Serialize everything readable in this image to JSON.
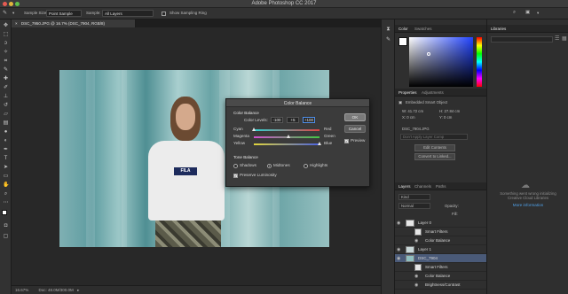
{
  "window": {
    "title": "Adobe Photoshop CC 2017"
  },
  "options_bar": {
    "sample_size_label": "Sample Size:",
    "sample_size_value": "Point Sample",
    "sample_value": "All Layers",
    "show_sampling_ring": "Show Sampling Ring"
  },
  "document": {
    "tab_label": "DSC_7950.JPG @ 16.7% (DSC_7904, RGB/8)",
    "zoom": "16.67%",
    "doc_info": "Doc: 48.0M/300.0M"
  },
  "dialog": {
    "title": "Color Balance",
    "section_color": "Color Balance",
    "color_levels_label": "Color Levels:",
    "levels": [
      "-100",
      "+5",
      "+100"
    ],
    "sliders": [
      {
        "left": "Cyan",
        "right": "Red",
        "value": -100
      },
      {
        "left": "Magenta",
        "right": "Green",
        "value": 5
      },
      {
        "left": "Yellow",
        "right": "Blue",
        "value": 100
      }
    ],
    "section_tone": "Tone Balance",
    "tones": [
      "Shadows",
      "Midtones",
      "Highlights"
    ],
    "preserve_luminosity": "Preserve Luminosity",
    "ok": "OK",
    "cancel": "Cancel",
    "preview": "Preview"
  },
  "color_panel": {
    "tabs": [
      "Color",
      "Swatches"
    ]
  },
  "properties": {
    "tabs": [
      "Properties",
      "Adjustments"
    ],
    "type": "Embedded Smart Object",
    "w": "W: 41.72 cm",
    "h": "H: 27.84 cm",
    "x": "X: 0 cm",
    "y": "Y: 0 cm",
    "filename": "DSC_7904.JPG",
    "layer_comp": "Don't Apply Layer Comp",
    "edit_contents": "Edit Contents",
    "convert": "Convert to Linked..."
  },
  "layers_panel": {
    "tabs": [
      "Layers",
      "Channels",
      "Paths"
    ],
    "kind": "Kind",
    "blend": "Normal",
    "opacity": "Opacity:",
    "fill": "Fill:",
    "rows": [
      {
        "name": "Layer 0",
        "selected": false
      },
      {
        "name": "Smart Filters",
        "selected": false
      },
      {
        "name": "Color Balance",
        "selected": false
      },
      {
        "name": "Layer 1",
        "selected": false
      },
      {
        "name": "DSC_7904",
        "selected": true
      },
      {
        "name": "Smart Filters",
        "selected": false
      },
      {
        "name": "Color Balance",
        "selected": false
      },
      {
        "name": "Brightness/Contrast",
        "selected": false
      }
    ]
  },
  "libraries": {
    "tab": "Libraries",
    "message": "Something went wrong initializing Creative Cloud Libraries",
    "more_info": "More information"
  },
  "colors": {
    "accent": "#4a5a78",
    "link": "#4fa0e8"
  }
}
